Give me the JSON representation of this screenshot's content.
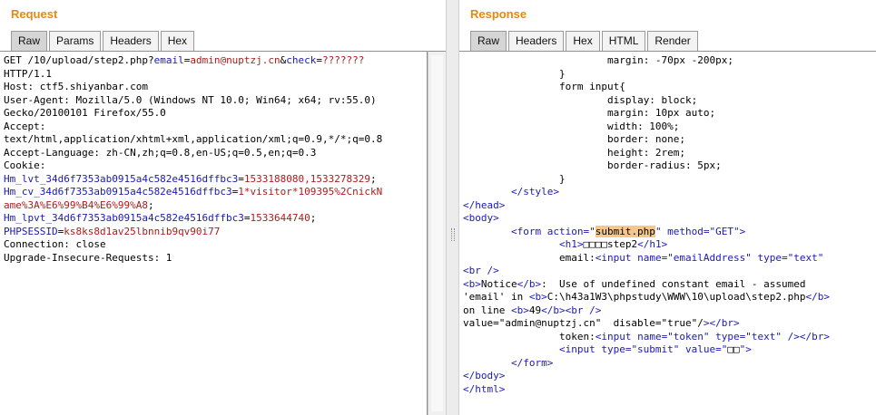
{
  "request": {
    "title": "Request",
    "tabs": [
      "Raw",
      "Params",
      "Headers",
      "Hex"
    ],
    "lines": {
      "l1a": "GET /10/upload/step2.php?",
      "l1b": "email",
      "l1c": "=",
      "l1d": "admin@nuptzj.cn",
      "l1e": "&",
      "l1f": "check",
      "l1g": "=",
      "l1h": "???????",
      "l2": "HTTP/1.1",
      "l3": "Host: ctf5.shiyanbar.com",
      "l4": "User-Agent: Mozilla/5.0 (Windows NT 10.0; Win64; x64; rv:55.0)",
      "l5": "Gecko/20100101 Firefox/55.0",
      "l6": "Accept:",
      "l7": "text/html,application/xhtml+xml,application/xml;q=0.9,*/*;q=0.8",
      "l8": "Accept-Language: zh-CN,zh;q=0.8,en-US;q=0.5,en;q=0.3",
      "l9": "Cookie:",
      "c1k": "Hm_lvt_34d6f7353ab0915a4c582e4516dffbc3",
      "c1v": "1533188080,1533278329",
      "c2k": "Hm_cv_34d6f7353ab0915a4c582e4516dffbc3",
      "c2v": "1*visitor*109395%2CnickN",
      "c2v2": "ame%3A%E6%99%B4%E6%99%A8",
      "c3k": "Hm_lpvt_34d6f7353ab0915a4c582e4516dffbc3",
      "c3v": "1533644740",
      "c4k": "PHPSESSID",
      "c4v": "ks8ks8d1av25lbnnib9qv90i77",
      "l10": "Connection: close",
      "l11": "Upgrade-Insecure-Requests: 1"
    }
  },
  "response": {
    "title": "Response",
    "tabs": [
      "Raw",
      "Headers",
      "Hex",
      "HTML",
      "Render"
    ],
    "lines": {
      "r1": "margin: -70px -200px;",
      "r2": "}",
      "r3": "form input{",
      "r4": "display: block;",
      "r5": "margin: 10px auto;",
      "r6": "width: 100%;",
      "r7": "border: none;",
      "r8": "height: 2rem;",
      "r9": "border-radius: 5px;",
      "r10": "}",
      "r11": "</style>",
      "r12": "</head>",
      "r13": "<body>",
      "r14a": "<form action=\"",
      "r14b": "submit.php",
      "r14c": "\" method=\"GET\">",
      "r15a": "<h1>",
      "r15b": "□□□□step2",
      "r15c": "</h1>",
      "r16a": "email:",
      "r16b": "<input name=\"emailAddress\" type=\"text\"",
      "r17": "<br />",
      "r18a": "<b>",
      "r18b": "Notice",
      "r18c": "</b>",
      "r18d": ":  Use of undefined constant email - assumed",
      "r19a": "'email' in ",
      "r19b": "<b>",
      "r19c": "C:\\h43a1W3\\phpstudy\\WWW\\10\\upload\\step2.php",
      "r19d": "</b>",
      "r20a": "on line ",
      "r20b": "<b>",
      "r20c": "49",
      "r20d": "</b><br />",
      "r21a": "value=\"admin@nuptzj.cn\"  disable=\"true\"/",
      "r21b": "></br>",
      "r22a": "token:",
      "r22b": "<input name=\"token\" type=\"text\" />",
      "r22c": "</br>",
      "r23a": "<input type=\"submit\" value=\"",
      "r23b": "□□",
      "r23c": "\">",
      "r24": "</form>",
      "r25": "</body>",
      "r26": "</html>"
    }
  }
}
